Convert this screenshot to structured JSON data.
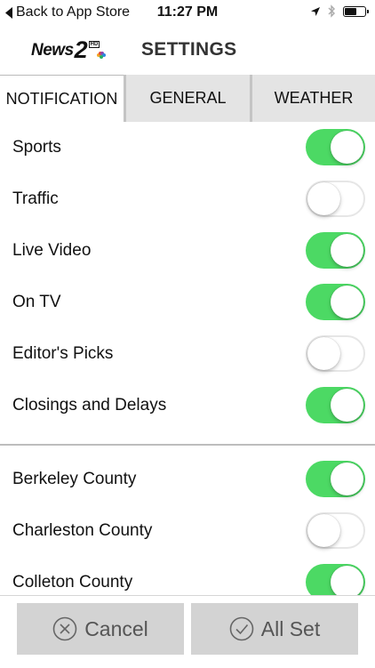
{
  "status_bar": {
    "back_label": "Back to App Store",
    "time": "11:27 PM",
    "battery_level": 0.65
  },
  "header": {
    "logo_text": "News",
    "logo_number": "2",
    "logo_badge": "HD",
    "title": "SETTINGS"
  },
  "tabs": [
    {
      "label": "NOTIFICATION",
      "active": true
    },
    {
      "label": "GENERAL",
      "active": false
    },
    {
      "label": "WEATHER",
      "active": false
    }
  ],
  "notification_settings": [
    {
      "label": "Sports",
      "on": true
    },
    {
      "label": "Traffic",
      "on": false
    },
    {
      "label": "Live Video",
      "on": true
    },
    {
      "label": "On TV",
      "on": true
    },
    {
      "label": "Editor's Picks",
      "on": false
    },
    {
      "label": "Closings and Delays",
      "on": true
    }
  ],
  "county_settings": [
    {
      "label": "Berkeley County",
      "on": true
    },
    {
      "label": "Charleston County",
      "on": false
    },
    {
      "label": "Colleton County",
      "on": true
    }
  ],
  "footer": {
    "cancel_label": "Cancel",
    "cancel_icon": "x-circle-icon",
    "allset_label": "All Set",
    "allset_icon": "check-circle-icon"
  },
  "colors": {
    "toggle_on": "#4cd964",
    "button_bg": "#d3d3d3"
  }
}
